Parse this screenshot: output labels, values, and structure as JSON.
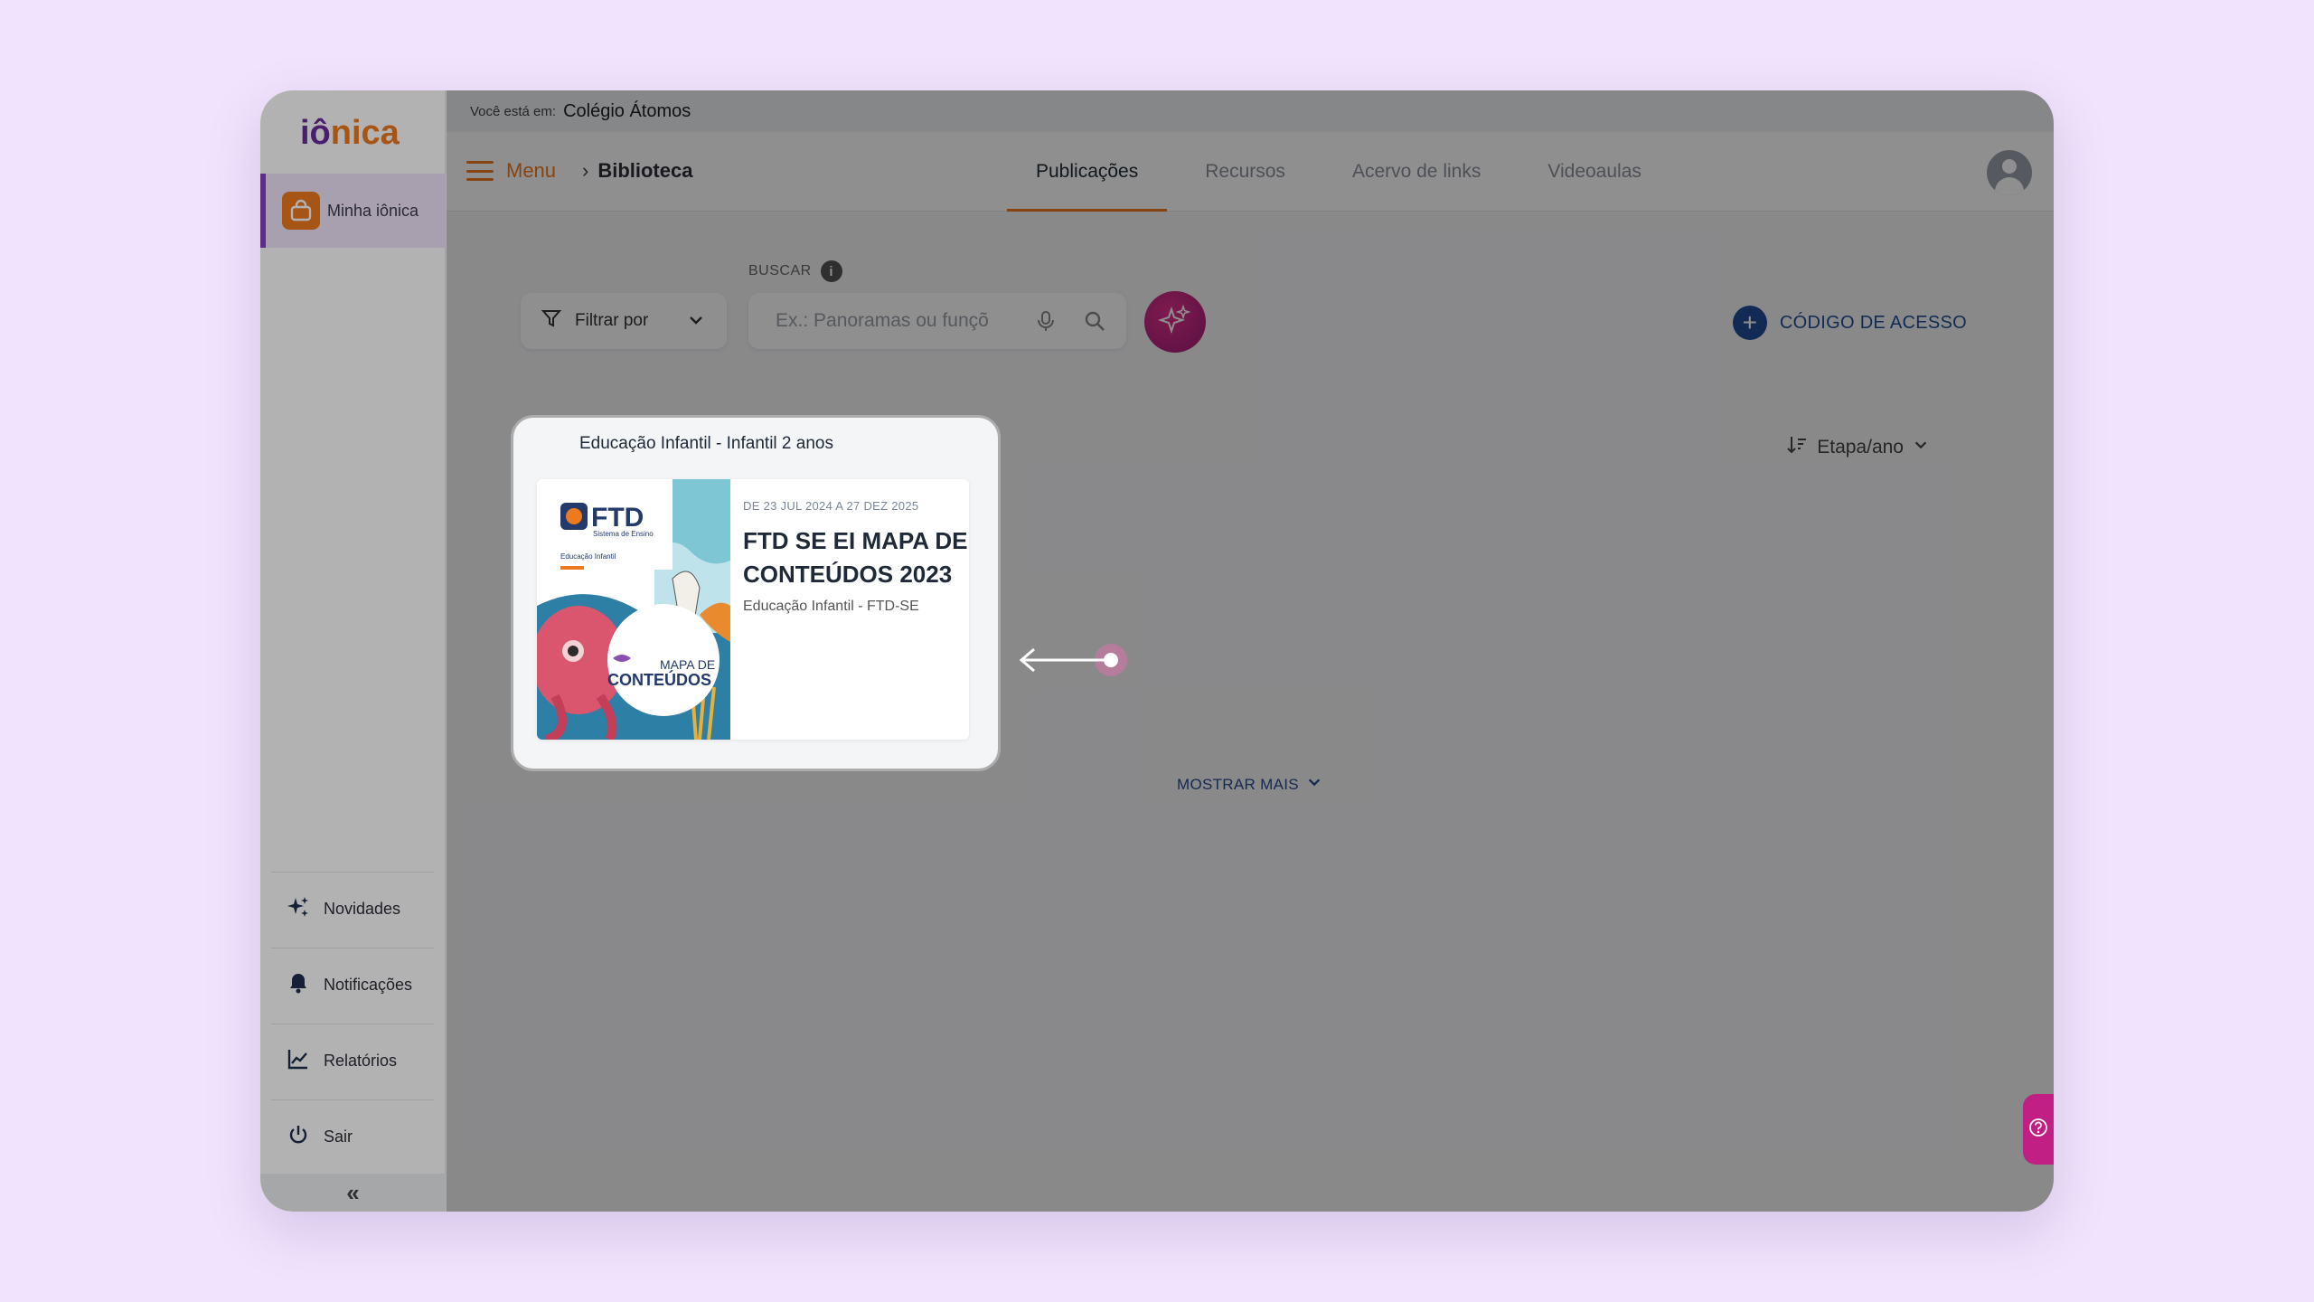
{
  "app": {
    "logo_part1": "iô",
    "logo_part2": "nica"
  },
  "sidebar": {
    "main_item": "Minha iônica",
    "items": [
      {
        "label": "Novidades",
        "icon": "sparkles-icon"
      },
      {
        "label": "Notificações",
        "icon": "bell-icon"
      },
      {
        "label": "Relatórios",
        "icon": "chart-icon"
      },
      {
        "label": "Sair",
        "icon": "power-icon"
      }
    ],
    "collapse_label": "«"
  },
  "breadcrumb_bar": {
    "prefix": "Você está em:",
    "school": "Colégio Átomos"
  },
  "topbar": {
    "menu_label": "Menu",
    "current_page": "Biblioteca",
    "tabs": [
      "Publicações",
      "Recursos",
      "Acervo de links",
      "Videoaulas"
    ],
    "active_tab": "Publicações"
  },
  "toolbar": {
    "filter_label": "Filtrar por",
    "search_label": "BUSCAR",
    "search_placeholder": "Ex.: Panoramas ou funçõ",
    "access_code_label": "CÓDIGO DE ACESSO",
    "sort_label": "Etapa/ano"
  },
  "publications": {
    "group_title": "Educação Infantil - Infantil 2 anos",
    "items": [
      {
        "date_range": "DE 23 JUL 2024 A 27 DEZ 2025",
        "title": "FTD SE EI MAPA DE CONTEÚDOS 2023",
        "subtitle": "Educação Infantil - FTD-SE",
        "cover_brand": "FTD",
        "cover_brand_sub": "Sistema de Ensino",
        "cover_line1": "Educação Infantil",
        "cover_heading1": "MAPA DE",
        "cover_heading2": "CONTEÚDOS"
      }
    ],
    "show_more_label": "MOSTRAR MAIS"
  },
  "colors": {
    "brand_orange": "#ee7a1f",
    "brand_purple": "#6a2ca0",
    "link_blue": "#1f4e96",
    "ai_magenta": "#c21f84"
  }
}
